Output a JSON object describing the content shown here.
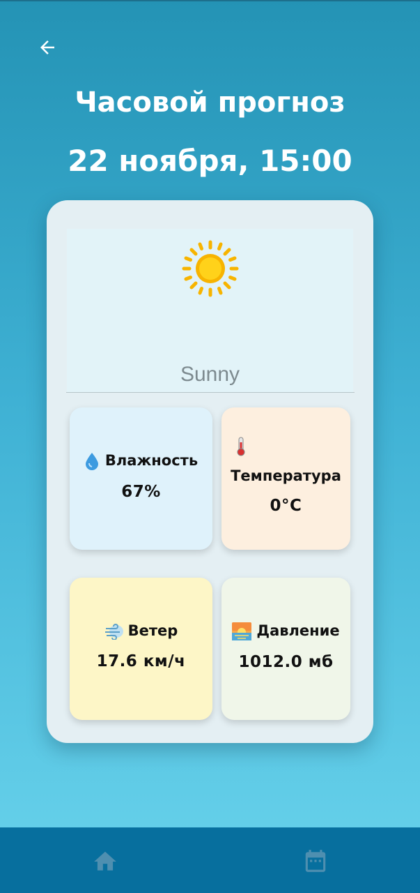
{
  "header": {
    "back_icon": "arrow-left-icon",
    "title": "Часовой прогноз",
    "datetime": "22 ноября, 15:00"
  },
  "weather": {
    "icon": "sun-icon",
    "condition": "Sunny"
  },
  "tiles": {
    "humidity": {
      "icon": "droplet-icon",
      "label": "Влажность",
      "value": "67%"
    },
    "temperature": {
      "icon": "thermometer-icon",
      "label": "Температура",
      "value": "0°C"
    },
    "wind": {
      "icon": "wind-icon",
      "label": "Ветер",
      "value": "17.6 км/ч"
    },
    "pressure": {
      "icon": "sunrise-icon",
      "label": "Давление",
      "value": "1012.0 мб"
    }
  },
  "nav": {
    "home_icon": "home-icon",
    "calendar_icon": "calendar-icon"
  },
  "colors": {
    "background_top": "#2493b5",
    "background_bottom": "#69d3ec",
    "nav_bar": "#076f9e",
    "humidity_tile": "#dff2fb",
    "temperature_tile": "#fdefdf",
    "wind_tile": "#fdf6c7",
    "pressure_tile": "#f0f6e9"
  }
}
